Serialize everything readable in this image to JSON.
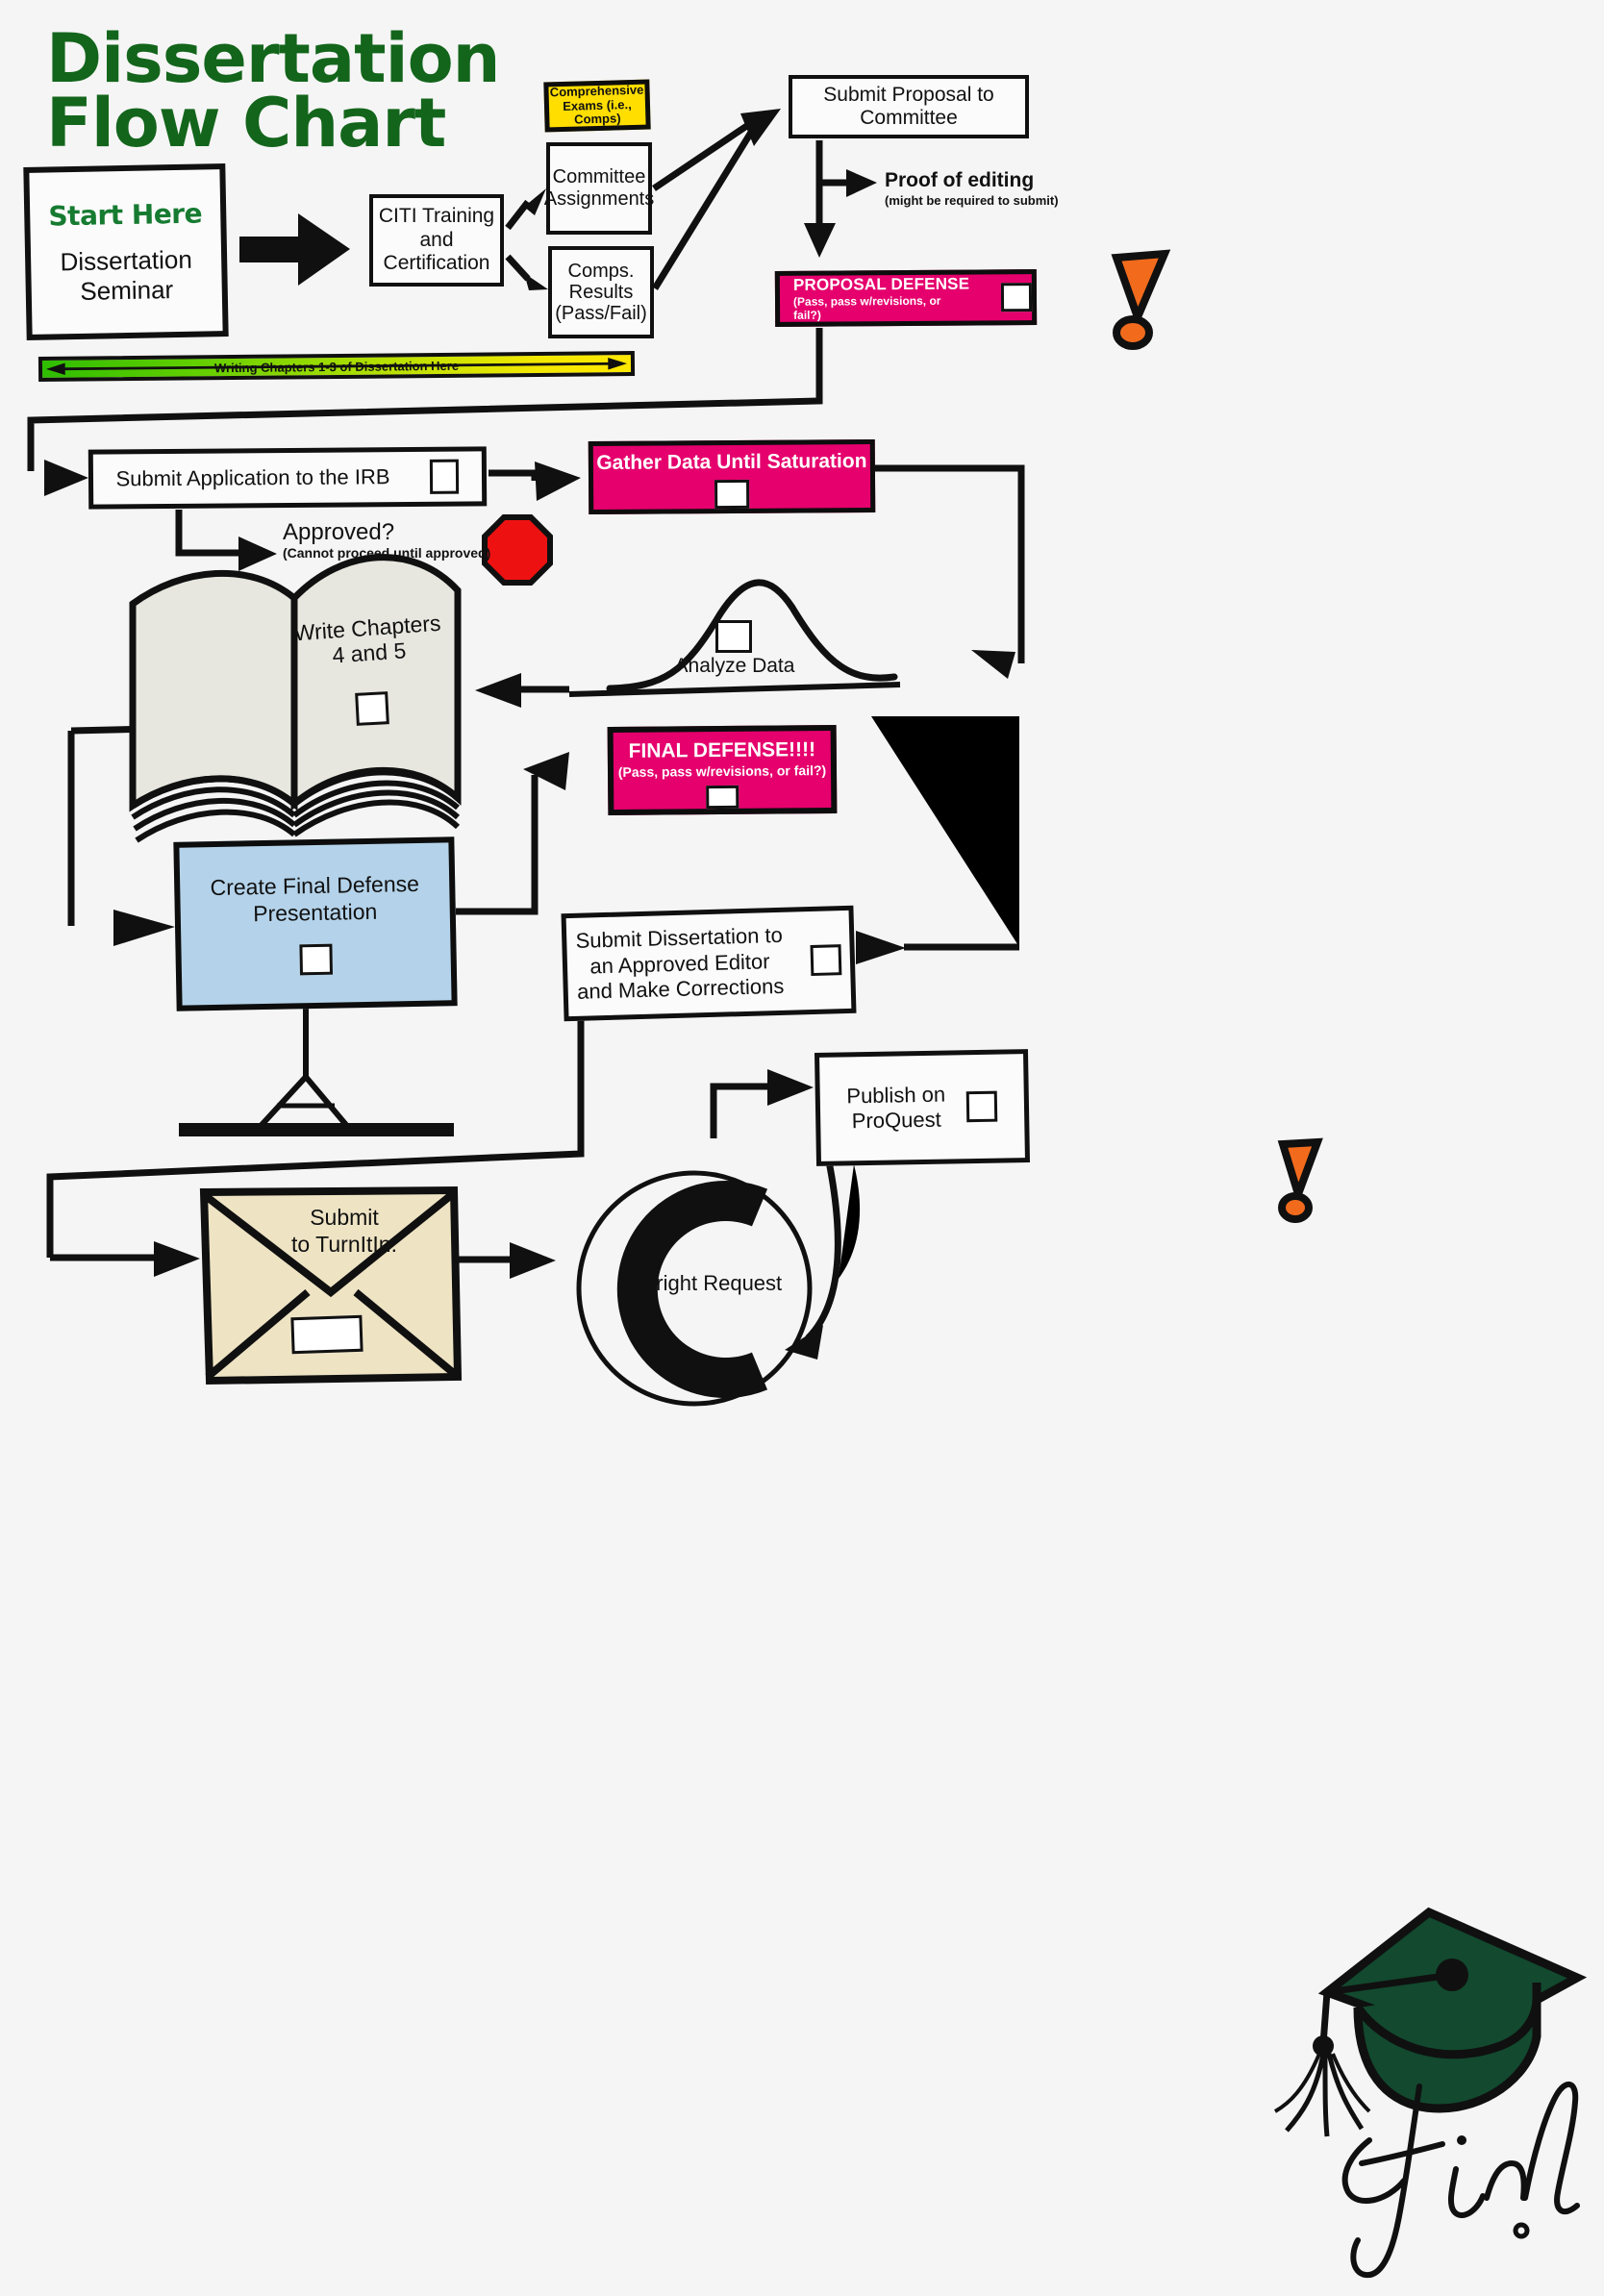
{
  "title": {
    "line1": "Dissertation",
    "line2": "Flow Chart"
  },
  "colors": {
    "title_green": "#13651b",
    "start_green": "#167b31",
    "defense_pink": "#e5006d",
    "comps_yellow": "#ffde00",
    "stop_red": "#ee1111",
    "warning_orange": "#f26b1d",
    "presentation_blue": "#b4d3ea",
    "envelope_cream": "#eee4c4",
    "book_paper": "#e7e7e0",
    "cap_green": "#12492f",
    "outline_black": "#101010",
    "background": "#f5f5f5"
  },
  "nodes": {
    "start": {
      "badge": "Start Here",
      "label": "Dissertation\nSeminar",
      "label_line1": "Dissertation",
      "label_line2": "Seminar"
    },
    "citi": {
      "line1": "CITI Training",
      "line2": "and Certification"
    },
    "comps_exams": {
      "line1": "Comprehensive",
      "line2": "Exams (i.e., Comps)"
    },
    "committee": {
      "line1": "Committee",
      "line2": "Assignments"
    },
    "comps_results": {
      "line1": "Comps.",
      "line2": "Results",
      "line3": "(Pass/Fail)"
    },
    "submit_proposal": {
      "label": "Submit Proposal to Committee"
    },
    "proof_editing": {
      "main": "Proof of editing",
      "sub": "(might be required to submit)"
    },
    "proposal_defense": {
      "title": "PROPOSAL DEFENSE",
      "sub": "(Pass, pass w/revisions, or fail?)",
      "checkbox": ""
    },
    "writing_bar": {
      "label": "Writing Chapters 1-3 of Dissertation Here"
    },
    "irb": {
      "label": "Submit Application to the IRB",
      "checkbox": ""
    },
    "approved": {
      "main": "Approved?",
      "sub": "(Cannot proceed until approved)"
    },
    "gather_data": {
      "title": "Gather Data Until Saturation",
      "checkbox": ""
    },
    "write_chapters": {
      "line1": "Write Chapters",
      "line2": "4 and 5",
      "checkbox": ""
    },
    "analyze_data": {
      "label": "Analyze Data",
      "checkbox": ""
    },
    "final_defense": {
      "title": "FINAL DEFENSE!!!!",
      "sub": "(Pass, pass w/revisions, or fail?)",
      "checkbox": ""
    },
    "presentation": {
      "line1": "Create Final Defense",
      "line2": "Presentation",
      "checkbox": ""
    },
    "editor": {
      "line1": "Submit Dissertation to",
      "line2": "an Approved Editor",
      "line3": "and Make Corrections",
      "checkbox": ""
    },
    "proquest": {
      "line1": "Publish on",
      "line2": "ProQuest",
      "checkbox": ""
    },
    "turnitin": {
      "line1": "Submit",
      "line2": "to TurnItIn.",
      "checkbox": ""
    },
    "copyright": {
      "label": "opyright Request",
      "symbol": "C"
    },
    "finis": {
      "label": "Fin"
    }
  },
  "icons": {
    "warning_proposal": "warning-exclamation-icon",
    "warning_final": "warning-exclamation-icon",
    "stop": "stop-sign-icon",
    "book": "open-book-icon",
    "projector": "projector-screen-icon",
    "envelope": "envelope-icon",
    "copyright": "copyright-icon",
    "grad_cap": "graduation-cap-icon",
    "big_arrow": "thick-right-arrow-icon"
  }
}
